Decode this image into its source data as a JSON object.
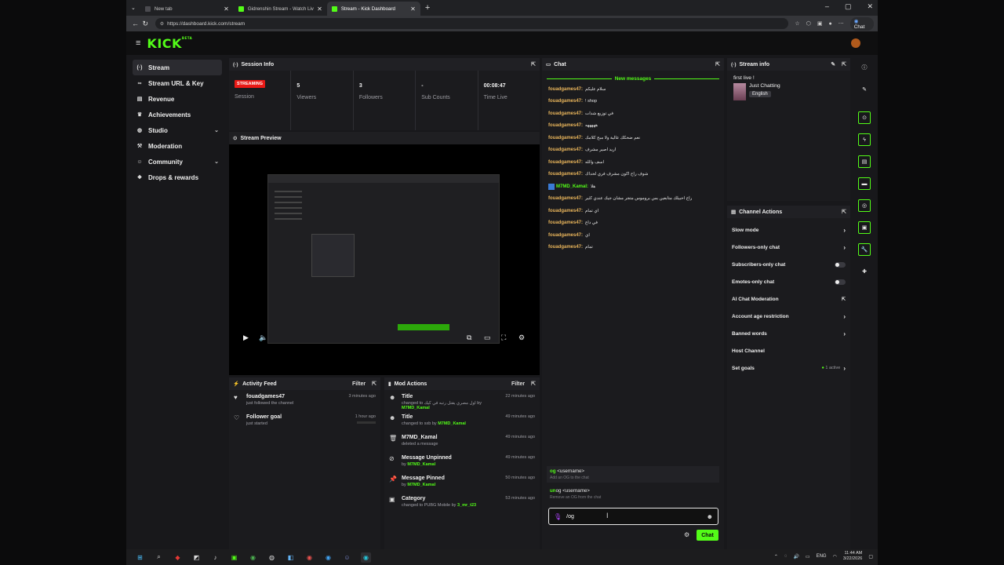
{
  "browser": {
    "tabs": [
      {
        "title": "New tab",
        "favicon_color": "#4a4a4f"
      },
      {
        "title": "Gidrenshin Stream - Watch Live o",
        "favicon_color": "#53fc18"
      },
      {
        "title": "Stream - Kick Dashboard",
        "favicon_color": "#53fc18"
      }
    ],
    "url": "https://dashboard.kick.com/stream",
    "chat_pill": "Chat"
  },
  "header": {
    "logo": "KICK",
    "logo_sup": "BETA"
  },
  "sidebar": {
    "items": [
      {
        "label": "Stream",
        "icon": "broadcast-icon",
        "active": true
      },
      {
        "label": "Stream URL & Key",
        "icon": "link-icon"
      },
      {
        "label": "Revenue",
        "icon": "money-icon"
      },
      {
        "label": "Achievements",
        "icon": "trophy-icon"
      },
      {
        "label": "Studio",
        "icon": "studio-icon",
        "chevron": true
      },
      {
        "label": "Moderation",
        "icon": "hammer-icon"
      },
      {
        "label": "Community",
        "icon": "community-icon",
        "chevron": true
      },
      {
        "label": "Drops & rewards",
        "icon": "gift-icon"
      }
    ]
  },
  "session": {
    "title": "Session Info",
    "badge": "STREAMING",
    "stats": [
      {
        "value": "",
        "label": "Session"
      },
      {
        "value": "5",
        "label": "Viewers"
      },
      {
        "value": "3",
        "label": "Followers"
      },
      {
        "value": "-",
        "label": "Sub Counts"
      },
      {
        "value": "00:08:47",
        "label": "Time Live"
      }
    ]
  },
  "preview": {
    "title": "Stream Preview"
  },
  "activity": {
    "title": "Activity Feed",
    "filter": "Filter",
    "items": [
      {
        "name": "fouadgames47",
        "desc": "just followed the channel",
        "time": "3 minutes ago"
      },
      {
        "name": "Follower goal",
        "desc": "just started",
        "time": "1 hour ago"
      }
    ]
  },
  "mod": {
    "title": "Mod Actions",
    "filter": "Filter",
    "items": [
      {
        "title": "Title",
        "desc": "changed to اول مصري يقتل رتبه في كيك",
        "by": "M7MD_Kamal",
        "time": "22 minutes ago"
      },
      {
        "title": "Title",
        "desc": "changed to sxb",
        "by": "M7MD_Kamal",
        "time": "49 minutes ago"
      },
      {
        "title": "M7MD_Kamal",
        "desc": "deleted a message",
        "by": "",
        "time": "49 minutes ago"
      },
      {
        "title": "Message Unpinned",
        "desc": "",
        "by": "M7MD_Kamal",
        "time": "49 minutes ago"
      },
      {
        "title": "Message Pinned",
        "desc": "",
        "by": "M7MD_Kamal",
        "time": "50 minutes ago"
      },
      {
        "title": "Category",
        "desc": "changed to PUBG Mobile",
        "by": "3_mr_t23",
        "time": "53 minutes ago"
      }
    ]
  },
  "chat": {
    "title": "Chat",
    "new_messages": "New messages",
    "messages": [
      {
        "user": "fouadgames47:",
        "text": "سلام عليكم"
      },
      {
        "user": "fouadgames47:",
        "text": "! shop"
      },
      {
        "user": "fouadgames47:",
        "text": "في توزيع شدات"
      },
      {
        "user": "fouadgames47:",
        "text": "هههههه"
      },
      {
        "user": "fouadgames47:",
        "text": "نعم ضحكك عالية ولا مبح كلامك"
      },
      {
        "user": "fouadgames47:",
        "text": "اريد اصير مشرف"
      },
      {
        "user": "fouadgames47:",
        "text": "اسف والله"
      },
      {
        "user": "fouadgames47:",
        "text": "شوف راح اكون مشرف فري لحداك"
      },
      {
        "user": "M7MD_Kamal:",
        "text": "هلا",
        "mod": true
      },
      {
        "user": "fouadgames47:",
        "text": "راح احبيلك متابعين بس بروموس متجر مشان جيك عندي كثير"
      },
      {
        "user": "fouadgames47:",
        "text": "اي تمام"
      },
      {
        "user": "fouadgames47:",
        "text": "في داع"
      },
      {
        "user": "fouadgames47:",
        "text": "اي"
      },
      {
        "user": "fouadgames47:",
        "text": "تمام"
      }
    ],
    "suggestions": [
      {
        "cmd_hl": "og",
        "cmd_rest": " <username>",
        "desc": "Add an OG to the chat"
      },
      {
        "cmd_hl": "un",
        "cmd_rest": "og <username>",
        "desc": "Remove an OG from the chat"
      }
    ],
    "input_value": "/og",
    "send_label": "Chat"
  },
  "stream_info": {
    "title": "Stream info",
    "stream_title": "first live !",
    "category": "Just Chatting",
    "language": "English"
  },
  "channel_actions": {
    "title": "Channel Actions",
    "items": [
      {
        "label": "Slow mode",
        "kind": "arrow"
      },
      {
        "label": "Followers-only chat",
        "kind": "arrow"
      },
      {
        "label": "Subscribers-only chat",
        "kind": "toggle"
      },
      {
        "label": "Emotes-only chat",
        "kind": "toggle"
      },
      {
        "label": "AI Chat Moderation",
        "kind": "external"
      },
      {
        "label": "Account age restriction",
        "kind": "arrow"
      },
      {
        "label": "Banned words",
        "kind": "arrow"
      },
      {
        "label": "Host Channel",
        "kind": "none"
      },
      {
        "label": "Set goals",
        "kind": "arrow",
        "extra": "1 active"
      }
    ]
  },
  "taskbar": {
    "lang": "ENG",
    "time": "11:44 AM",
    "date": "3/22/2026"
  }
}
